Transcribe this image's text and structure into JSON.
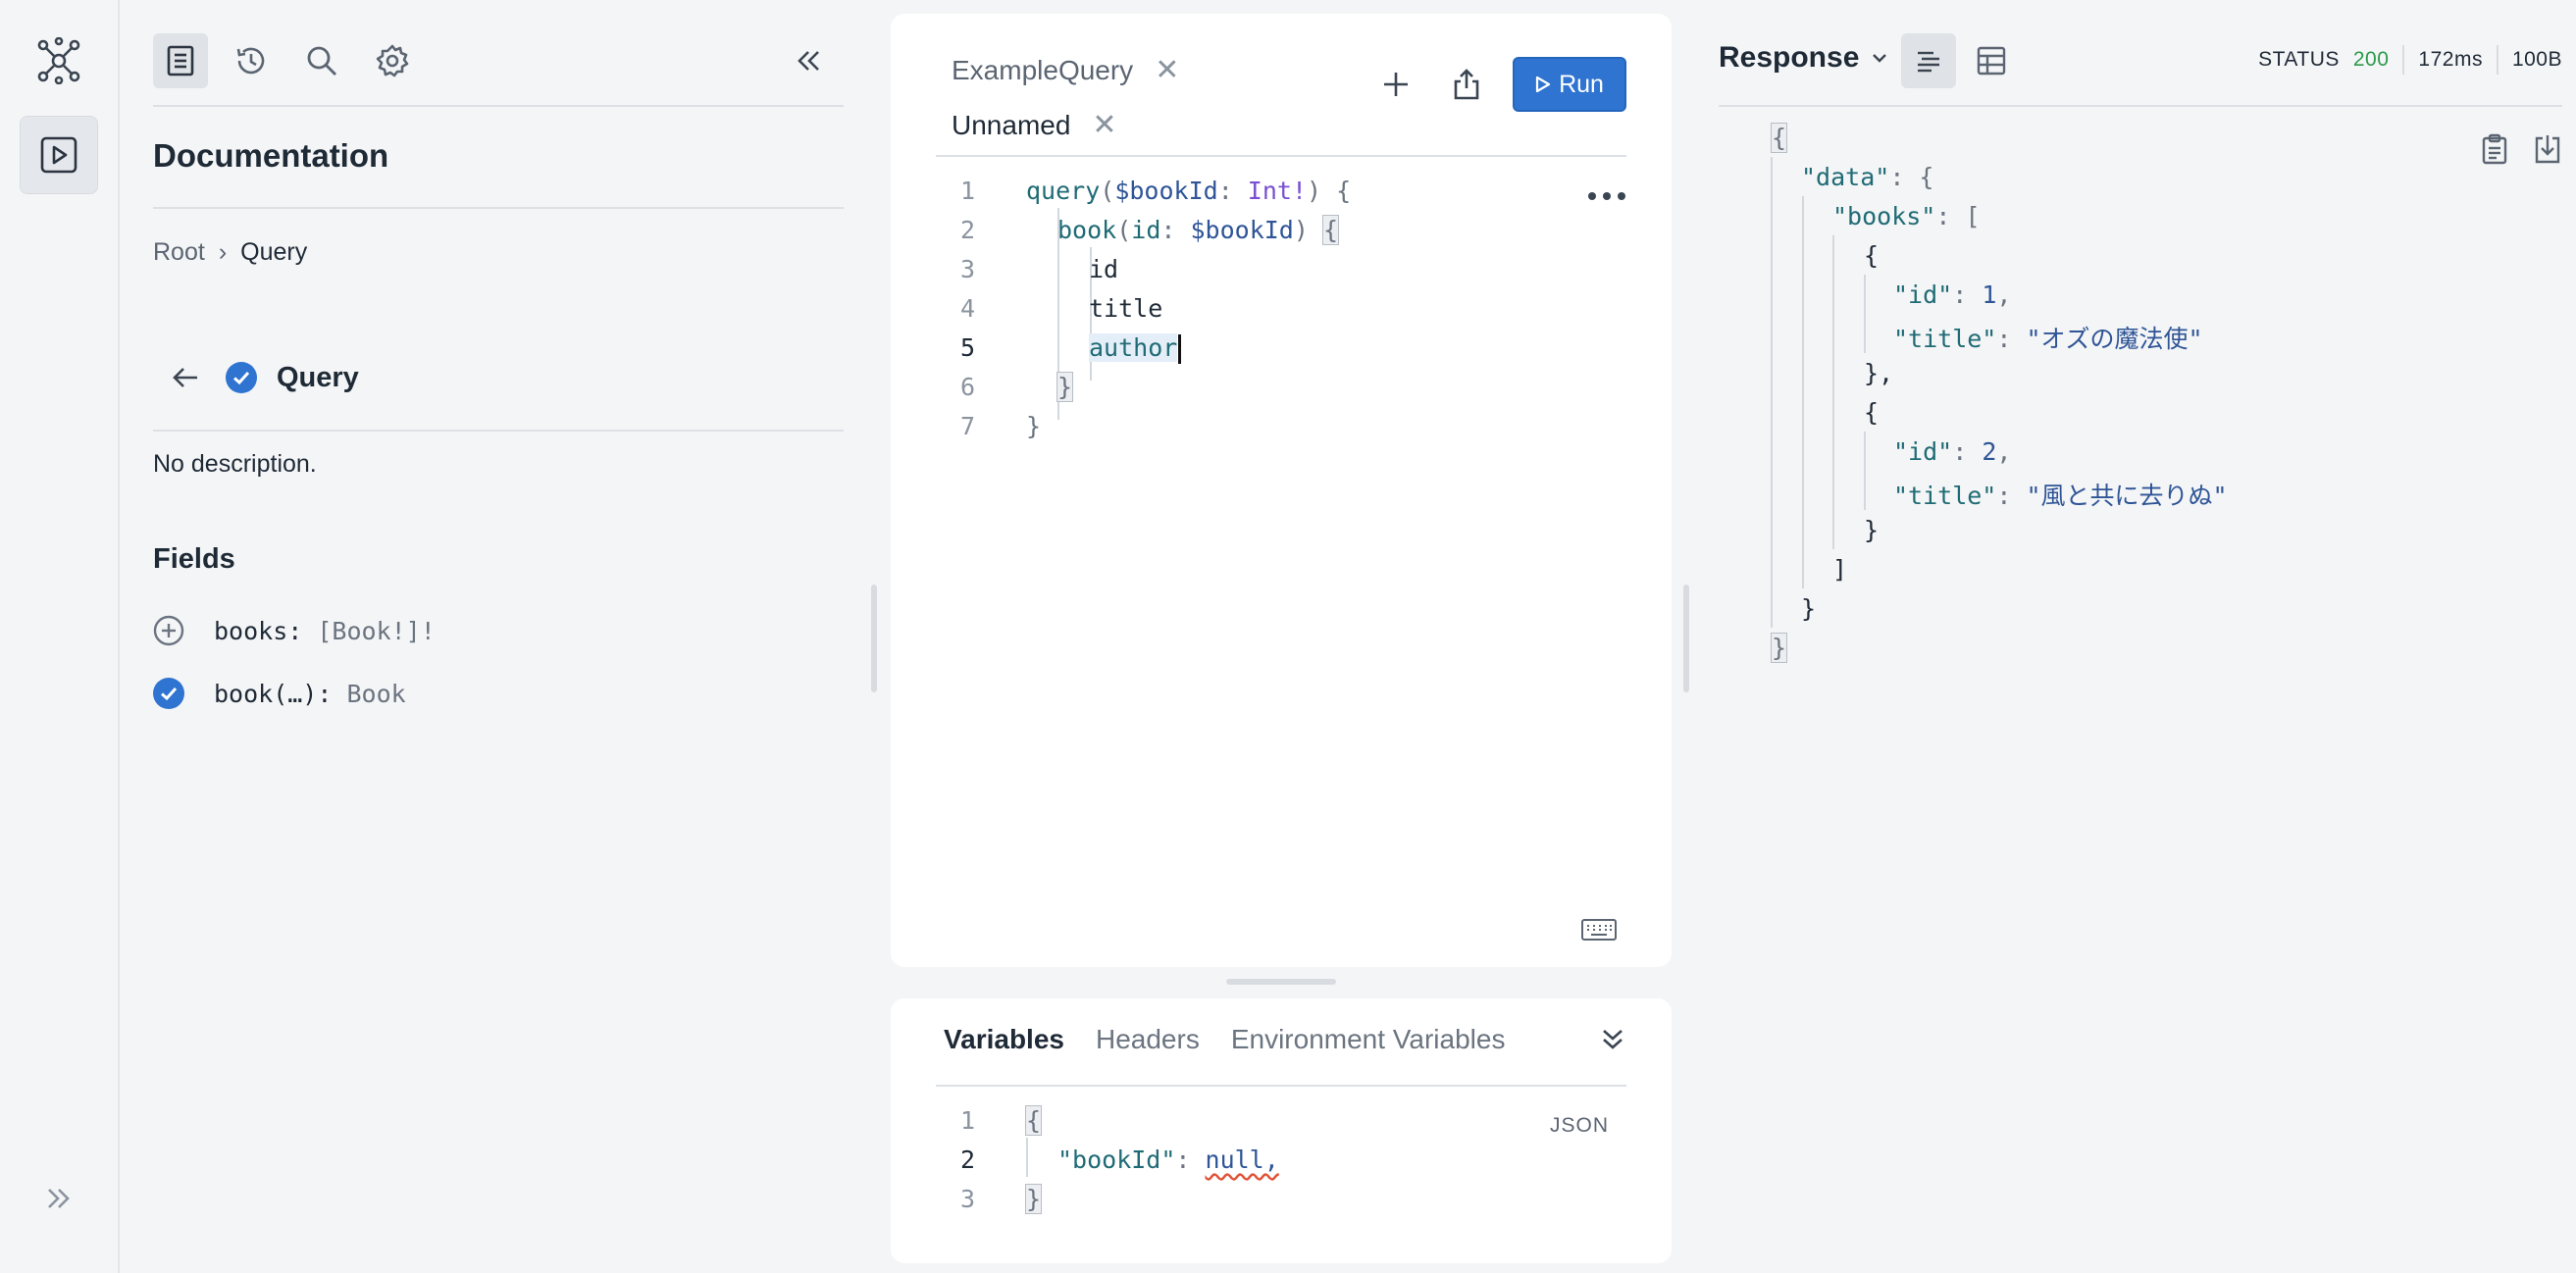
{
  "rail": {
    "items": [
      {
        "name": "graphql-logo-icon"
      },
      {
        "name": "playground-icon"
      },
      {
        "name": "expand-sidebar-icon"
      }
    ]
  },
  "docs": {
    "title": "Documentation",
    "breadcrumb": {
      "root": "Root",
      "separator": "›",
      "current": "Query"
    },
    "type_name": "Query",
    "description": "No description.",
    "fields_heading": "Fields",
    "fields": [
      {
        "name": "books",
        "sig": ": ",
        "type": "[Book!]!",
        "state": "add"
      },
      {
        "name": "book(…)",
        "sig": ": ",
        "type": "Book",
        "state": "checked"
      }
    ]
  },
  "editor": {
    "tabs": [
      {
        "label": "ExampleQuery",
        "active": false
      },
      {
        "label": "Unnamed",
        "active": true
      }
    ],
    "run_label": "Run",
    "line_numbers": [
      "1",
      "2",
      "3",
      "4",
      "5",
      "6",
      "7"
    ],
    "current_line": "5",
    "code": {
      "l1_kw": "query",
      "l1_var": "$bookId",
      "l1_type": "Int!",
      "l2_field": "book",
      "l2_arg": "id",
      "l2_var": "$bookId",
      "l3": "id",
      "l4": "title",
      "l5": "author"
    }
  },
  "variables": {
    "tabs": [
      "Variables",
      "Headers",
      "Environment Variables"
    ],
    "format_label": "JSON",
    "line_numbers": [
      "1",
      "2",
      "3"
    ],
    "key": "\"bookId\"",
    "value": "null,"
  },
  "response": {
    "title": "Response",
    "status_label": "STATUS",
    "status_code": "200",
    "time": "172ms",
    "size": "100B",
    "json": {
      "data_key": "\"data\"",
      "books_key": "\"books\"",
      "items": [
        {
          "id": "1",
          "title": "\"オズの魔法使\""
        },
        {
          "id": "2",
          "title": "\"風と共に去りぬ\""
        }
      ],
      "id_key": "\"id\"",
      "title_key": "\"title\""
    }
  },
  "colors": {
    "accent": "#2f74d0",
    "status_ok": "#2c9a4a",
    "background": "#f4f5f6"
  }
}
